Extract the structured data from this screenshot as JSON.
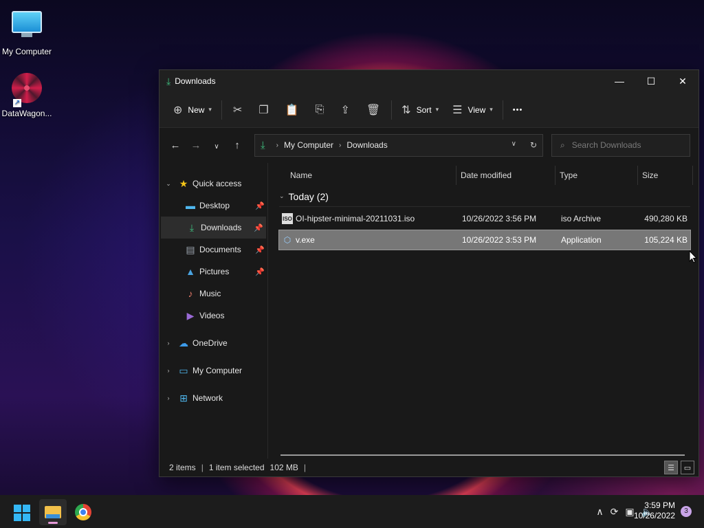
{
  "desktop": {
    "icons": [
      {
        "label": "My Computer",
        "icon": "monitor-icon"
      },
      {
        "label": "DataWagon...",
        "icon": "datawagon-logo-icon"
      }
    ]
  },
  "window": {
    "title": "Downloads",
    "controls": {
      "minimize": "—",
      "maximize": "☐",
      "close": "✕"
    }
  },
  "toolbar": {
    "new_label": "New",
    "sort_label": "Sort",
    "view_label": "View",
    "more_label": "•••"
  },
  "address": {
    "crumbs": [
      "My Computer",
      "Downloads"
    ],
    "search_placeholder": "Search Downloads"
  },
  "nav": {
    "quick_access": "Quick access",
    "items": [
      {
        "label": "Desktop",
        "icon": "desktop-icon",
        "pinned": true
      },
      {
        "label": "Downloads",
        "icon": "download-icon",
        "pinned": true
      },
      {
        "label": "Documents",
        "icon": "document-icon",
        "pinned": true
      },
      {
        "label": "Pictures",
        "icon": "picture-icon",
        "pinned": true
      },
      {
        "label": "Music",
        "icon": "music-icon",
        "pinned": false
      },
      {
        "label": "Videos",
        "icon": "video-icon",
        "pinned": false
      }
    ],
    "roots": [
      {
        "label": "OneDrive",
        "icon": "cloud-icon"
      },
      {
        "label": "My Computer",
        "icon": "computer-icon"
      },
      {
        "label": "Network",
        "icon": "network-icon"
      }
    ]
  },
  "files": {
    "columns": [
      "Name",
      "Date modified",
      "Type",
      "Size"
    ],
    "group": "Today (2)",
    "rows": [
      {
        "name": "OI-hipster-minimal-20211031.iso",
        "date": "10/26/2022 3:56 PM",
        "type": "iso Archive",
        "size": "490,280 KB",
        "icon": "iso-file-icon",
        "selected": false
      },
      {
        "name": "v.exe",
        "date": "10/26/2022 3:53 PM",
        "type": "Application",
        "size": "105,224 KB",
        "icon": "application-file-icon",
        "selected": true
      }
    ]
  },
  "status": {
    "items": "2 items",
    "selected": "1 item selected",
    "size": "102 MB"
  },
  "taskbar": {
    "time": "3:59 PM",
    "date": "10/26/2022",
    "notifications": "3"
  },
  "colors": {
    "accent": "#3fbf7f",
    "selection": "#777777",
    "taskbar": "#1c1c1c"
  }
}
